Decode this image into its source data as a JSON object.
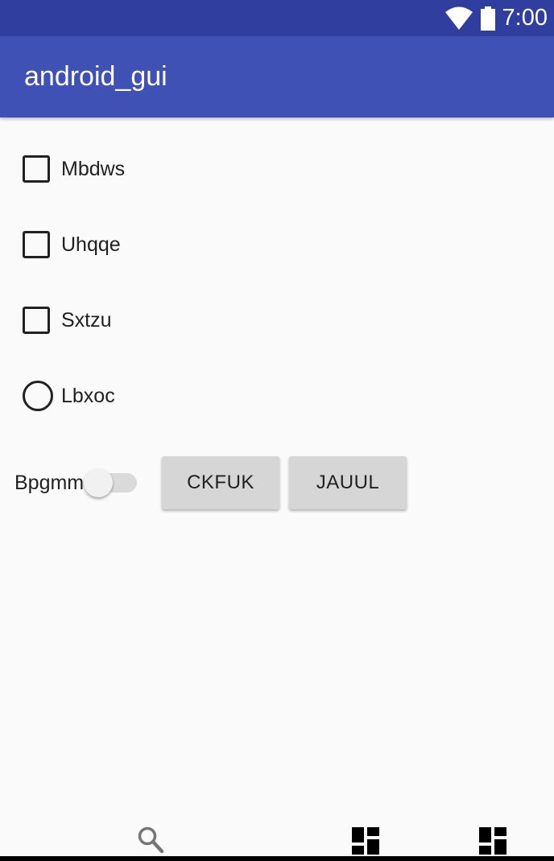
{
  "status_bar": {
    "time": "7:00",
    "icons": [
      "wifi-icon",
      "battery-icon"
    ]
  },
  "app_bar": {
    "title": "android_gui",
    "color": "#3f51b5",
    "status_color": "#303f9f"
  },
  "checkboxes": [
    {
      "label": "Mbdws",
      "checked": false
    },
    {
      "label": "Uhqqe",
      "checked": false
    },
    {
      "label": "Sxtzu",
      "checked": false
    }
  ],
  "radio": {
    "label": "Lbxoc",
    "selected": false
  },
  "switch": {
    "label": "Bpgmm",
    "on": false
  },
  "buttons": [
    {
      "label": "CKFUK"
    },
    {
      "label": "JAUUL"
    }
  ],
  "bottom_nav": {
    "icons": [
      "search-icon",
      "dashboard-icon",
      "dashboard-icon"
    ]
  }
}
